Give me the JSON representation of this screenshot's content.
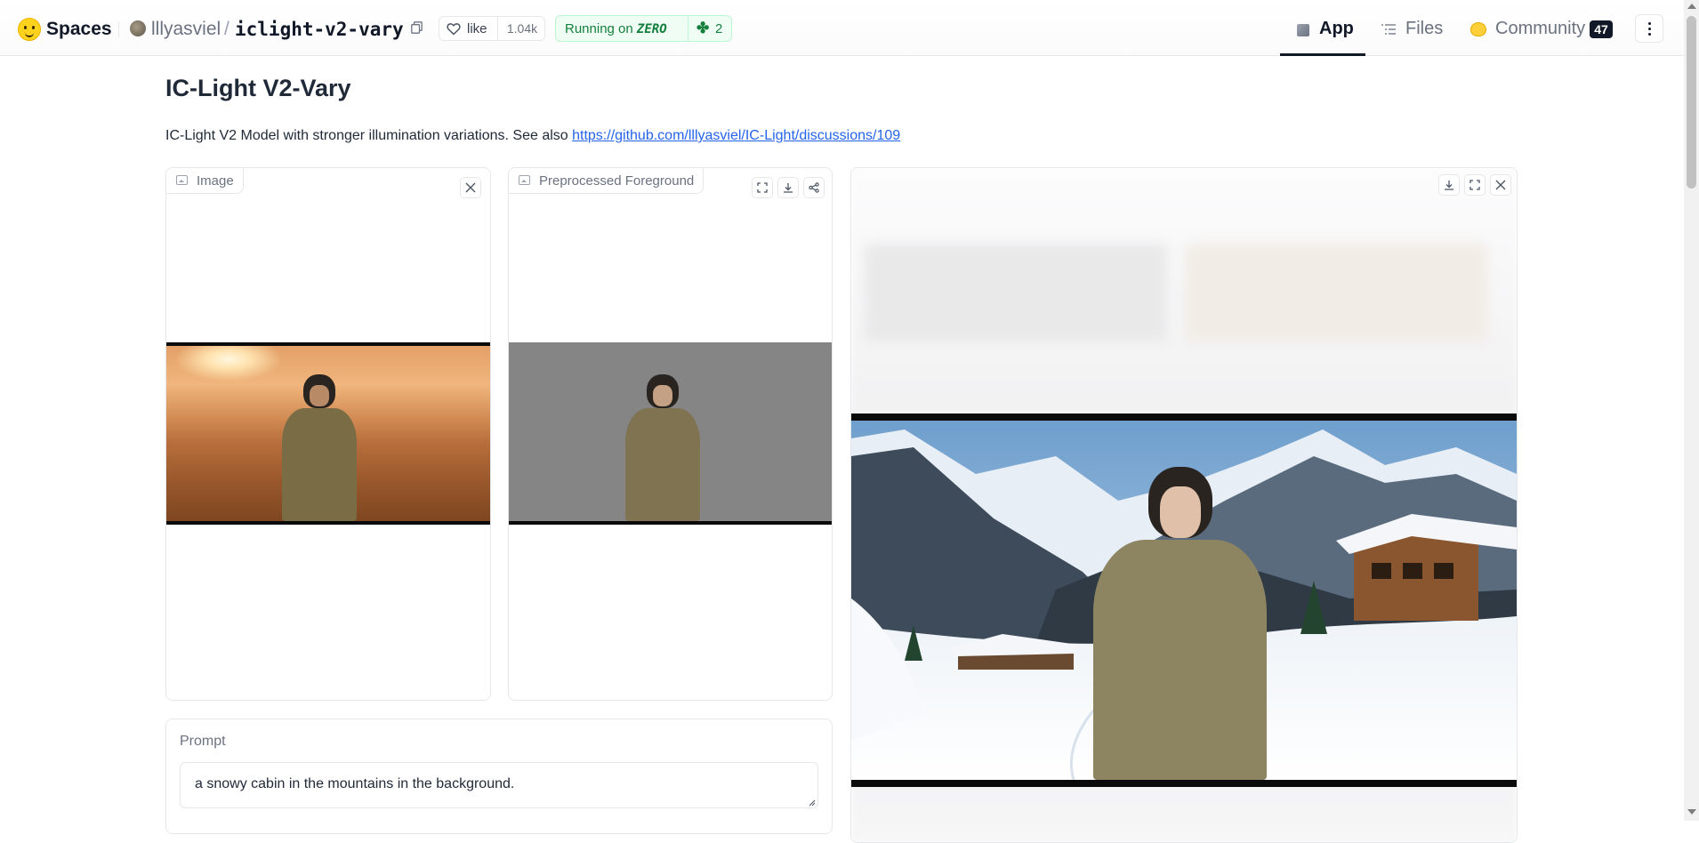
{
  "header": {
    "brand": "Spaces",
    "owner": "lllyasviel",
    "separator": "/",
    "repo": "iclight-v2-vary",
    "like_label": "like",
    "like_count": "1.04k",
    "status_running": "Running on",
    "status_hardware": "ZERO",
    "status_plus": "✤",
    "status_count": "2",
    "tabs": [
      {
        "label": "App",
        "active": true
      },
      {
        "label": "Files",
        "active": false
      },
      {
        "label": "Community",
        "active": false
      }
    ],
    "community_badge": "47"
  },
  "main": {
    "title": "IC-Light V2-Vary",
    "description_prefix": "IC-Light V2 Model with stronger illumination variations. See also ",
    "description_link": "https://github.com/lllyasviel/IC-Light/discussions/109"
  },
  "panels": {
    "image_label": "Image",
    "preprocessed_label": "Preprocessed Foreground"
  },
  "prompt": {
    "label": "Prompt",
    "value": "a snowy cabin in the mountains in the background."
  },
  "colors": {
    "accent_green": "#15803d",
    "link_blue": "#2563eb",
    "text_dark": "#1f2937"
  }
}
